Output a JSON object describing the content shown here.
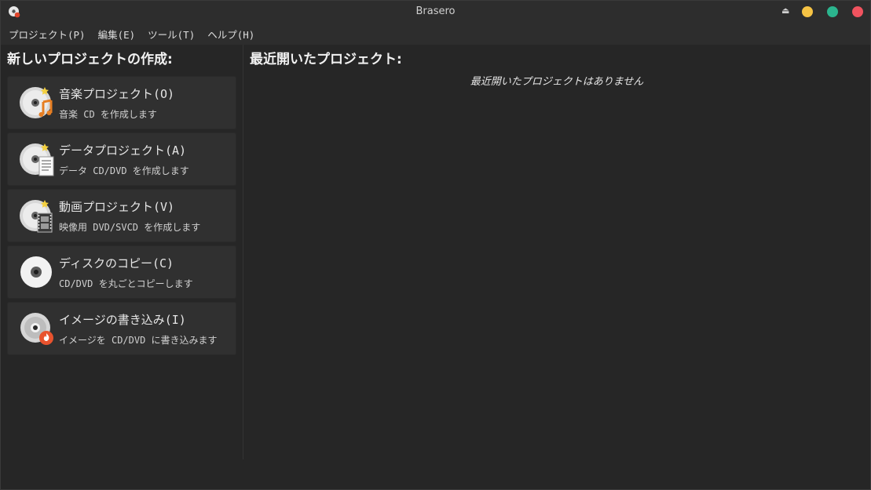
{
  "window": {
    "title": "Brasero",
    "colors": {
      "minimize": "#f6c344",
      "maximize": "#2bb58e",
      "close": "#f0535f"
    }
  },
  "menu": [
    {
      "label": "プロジェクト(P)"
    },
    {
      "label": "編集(E)"
    },
    {
      "label": "ツール(T)"
    },
    {
      "label": "ヘルプ(H)"
    }
  ],
  "new_project": {
    "heading": "新しいプロジェクトの作成:",
    "items": [
      {
        "label": "音楽プロジェクト(O)",
        "desc": "音楽 CD を作成します",
        "icon": "audio-project-icon"
      },
      {
        "label": "データプロジェクト(A)",
        "desc": "データ CD/DVD を作成します",
        "icon": "data-project-icon"
      },
      {
        "label": "動画プロジェクト(V)",
        "desc": "映像用 DVD/SVCD を作成します",
        "icon": "video-project-icon"
      },
      {
        "label": "ディスクのコピー(C)",
        "desc": "CD/DVD を丸ごとコピーします",
        "icon": "disc-copy-icon"
      },
      {
        "label": "イメージの書き込み(I)",
        "desc": "イメージを CD/DVD に書き込みます",
        "icon": "burn-image-icon"
      }
    ]
  },
  "recent": {
    "heading": "最近開いたプロジェクト:",
    "empty_message": "最近開いたプロジェクトはありません"
  }
}
